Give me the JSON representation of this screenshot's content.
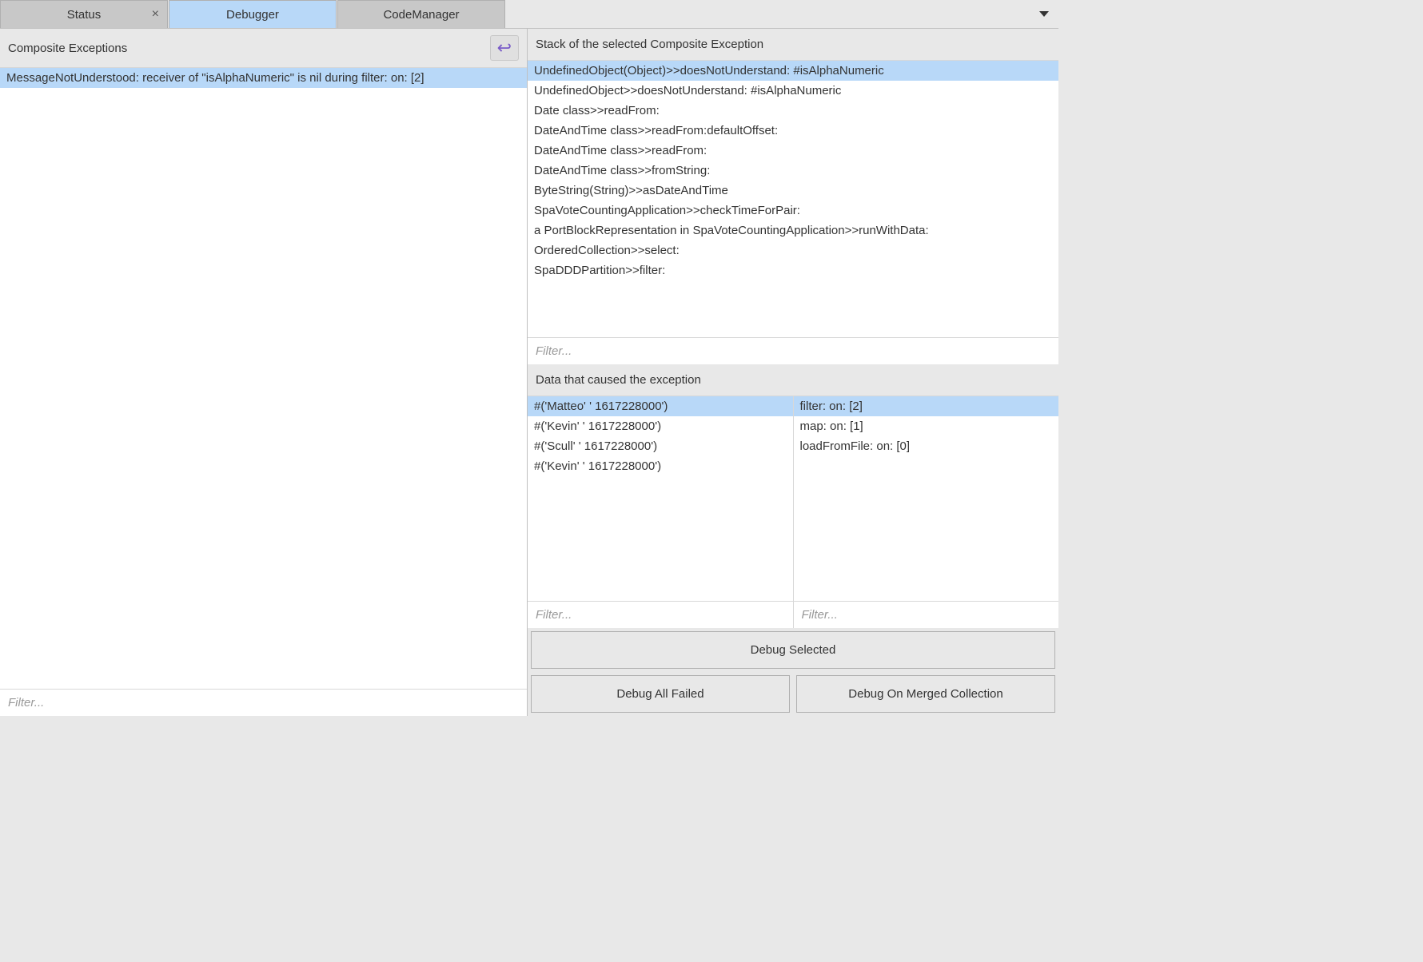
{
  "tabs": [
    {
      "label": "Status",
      "active": false,
      "closeable": true
    },
    {
      "label": "Debugger",
      "active": true,
      "closeable": false
    },
    {
      "label": "CodeManager",
      "active": false,
      "closeable": false
    }
  ],
  "leftPanel": {
    "header": "Composite Exceptions",
    "items": [
      "MessageNotUnderstood: receiver of \"isAlphaNumeric\" is nil during filter: on: [2]"
    ],
    "filterPlaceholder": "Filter..."
  },
  "rightPanel": {
    "stackHeader": "Stack of the selected Composite Exception",
    "stackItems": [
      "UndefinedObject(Object)>>doesNotUnderstand: #isAlphaNumeric",
      "UndefinedObject>>doesNotUnderstand: #isAlphaNumeric",
      "Date class>>readFrom:",
      "DateAndTime class>>readFrom:defaultOffset:",
      "DateAndTime class>>readFrom:",
      "DateAndTime class>>fromString:",
      "ByteString(String)>>asDateAndTime",
      "SpaVoteCountingApplication>>checkTimeForPair:",
      "a PortBlockRepresentation in SpaVoteCountingApplication>>runWithData:",
      "OrderedCollection>>select:",
      "SpaDDDPartition>>filter:"
    ],
    "stackFilterPlaceholder": "Filter...",
    "dataHeader": "Data that caused the exception",
    "dataLeft": [
      "#('Matteo' ' 1617228000')",
      "#('Kevin' ' 1617228000')",
      "#('Scull' ' 1617228000')",
      "#('Kevin' ' 1617228000')"
    ],
    "dataRight": [
      "filter: on: [2]",
      "map: on: [1]",
      "loadFromFile: on: [0]"
    ],
    "dataLeftFilterPlaceholder": "Filter...",
    "dataRightFilterPlaceholder": "Filter...",
    "buttons": {
      "debugSelected": "Debug Selected",
      "debugAllFailed": "Debug All Failed",
      "debugMerged": "Debug On Merged Collection"
    }
  }
}
